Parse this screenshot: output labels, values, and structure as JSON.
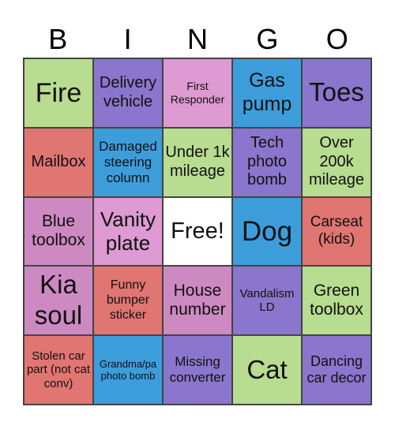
{
  "header": [
    "B",
    "I",
    "N",
    "G",
    "O"
  ],
  "colors": {
    "green": "#b8dc90",
    "purple": "#8a76cc",
    "lightpink": "#de9ad2",
    "pink": "#cd89c1",
    "blue": "#3d9ddb",
    "red": "#e07572",
    "white": "#ffffff"
  },
  "cells": [
    {
      "text": "Fire",
      "color": "green",
      "size": 34
    },
    {
      "text": "Delivery vehicle",
      "color": "purple",
      "size": 20
    },
    {
      "text": "First Responder",
      "color": "lightpink",
      "size": 14
    },
    {
      "text": "Gas pump",
      "color": "blue",
      "size": 25
    },
    {
      "text": "Toes",
      "color": "purple",
      "size": 33
    },
    {
      "text": "Mailbox",
      "color": "red",
      "size": 20
    },
    {
      "text": "Damaged steering column",
      "color": "blue",
      "size": 17
    },
    {
      "text": "Under 1k mileage",
      "color": "green",
      "size": 20
    },
    {
      "text": "Tech photo bomb",
      "color": "purple",
      "size": 20
    },
    {
      "text": "Over 200k mileage",
      "color": "green",
      "size": 20
    },
    {
      "text": "Blue toolbox",
      "color": "pink",
      "size": 21
    },
    {
      "text": "Vanity plate",
      "color": "lightpink",
      "size": 26
    },
    {
      "text": "Free!",
      "color": "white",
      "size": 29
    },
    {
      "text": "Dog",
      "color": "blue",
      "size": 35
    },
    {
      "text": "Carseat (kids)",
      "color": "red",
      "size": 19
    },
    {
      "text": "Kia soul",
      "color": "pink",
      "size": 33
    },
    {
      "text": "Funny bumper sticker",
      "color": "red",
      "size": 16
    },
    {
      "text": "House number",
      "color": "pink",
      "size": 21
    },
    {
      "text": "Vandalism LD",
      "color": "purple",
      "size": 15
    },
    {
      "text": "Green toolbox",
      "color": "green",
      "size": 21
    },
    {
      "text": "Stolen car part (not cat conv)",
      "color": "red",
      "size": 15
    },
    {
      "text": "Grandma/pa photo bomb",
      "color": "blue",
      "size": 13
    },
    {
      "text": "Missing converter",
      "color": "purple",
      "size": 17
    },
    {
      "text": "Cat",
      "color": "green",
      "size": 33
    },
    {
      "text": "Dancing car decor",
      "color": "purple",
      "size": 18
    }
  ]
}
